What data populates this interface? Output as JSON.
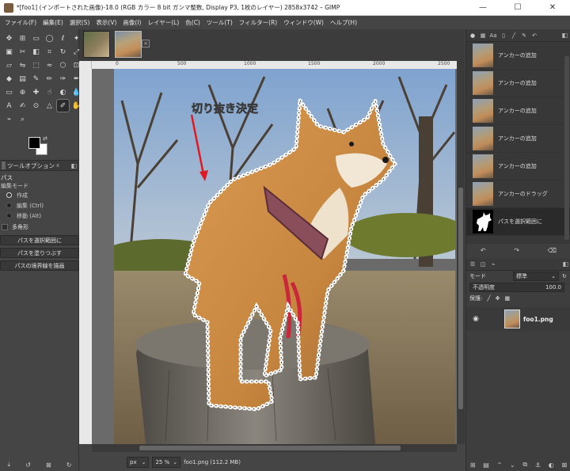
{
  "window": {
    "title": "*[foo1] (インポートされた画像)-18.0 (RGB カラー 8 bit ガンマ整数, Display P3, 1枚のレイヤー) 2858x3742 – GIMP",
    "minimize": "—",
    "maximize": "☐",
    "close": "✕"
  },
  "menu": [
    "ファイル(F)",
    "編集(E)",
    "選択(S)",
    "表示(V)",
    "画像(I)",
    "レイヤー(L)",
    "色(C)",
    "ツール(T)",
    "フィルター(R)",
    "ウィンドウ(W)",
    "ヘルプ(H)"
  ],
  "tool_options": {
    "tab_label": "ツールオプション",
    "tab_close": "x",
    "tool_name": "パス",
    "mode_label": "編集モード",
    "modes": [
      "作成",
      "編集 (Ctrl)",
      "移動 (Alt)"
    ],
    "selected_mode": 0,
    "polygon_label": "多角形",
    "buttons": [
      "パスを選択範囲に",
      "パスを塗りつぶす",
      "パスの境界線を描画"
    ]
  },
  "canvas": {
    "annotation": "切り抜き決定",
    "ruler_labels": [
      "0",
      "500",
      "1000",
      "1500",
      "2000",
      "2500"
    ],
    "unit": "px",
    "zoom": "25 %",
    "status_text": "foo1.png (112.2 MB)",
    "tab_close": "×"
  },
  "history": {
    "items": [
      "アンカーの追加",
      "アンカーの追加",
      "アンカーの追加",
      "アンカーの追加",
      "アンカーの追加",
      "アンカーのドラッグ",
      "パスを選択範囲に"
    ],
    "selected_index": 6
  },
  "layers": {
    "mode_label": "モード",
    "mode_value": "標準",
    "opacity_label": "不透明度",
    "opacity_value": "100.0",
    "lock_label": "保護:",
    "layer_name": "foo1.png"
  },
  "colors": {
    "accent": "#e01a22",
    "path": "#ffffff",
    "panel": "#454545"
  }
}
